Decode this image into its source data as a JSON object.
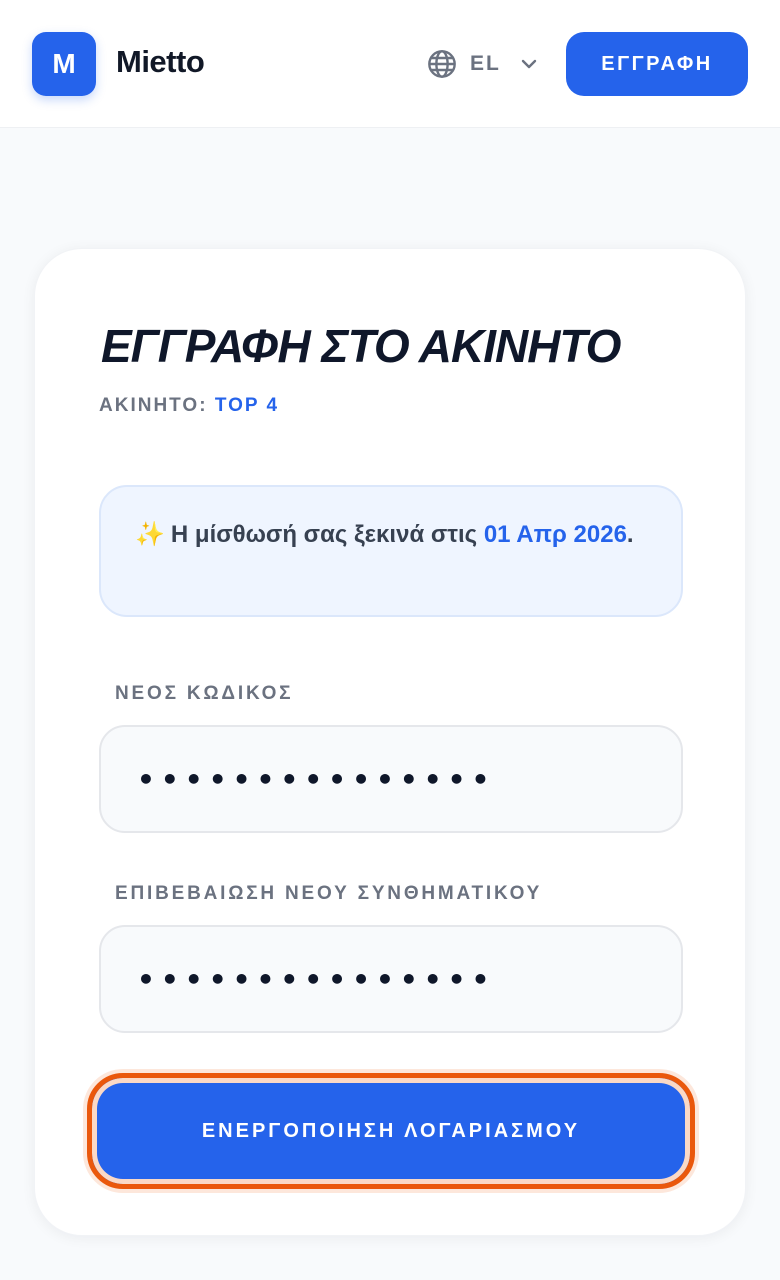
{
  "header": {
    "logo_letter": "M",
    "brand": "Mietto",
    "language_code": "EL",
    "signup_label": "ΕΓΓΡΑΦΗ"
  },
  "card": {
    "title": "ΕΓΓΡΑΦΗ ΣΤΟ ΑΚΙΝΗΤΟ",
    "property_label": "ΑΚΙΝΗΤΟ:",
    "property_value": "TOP 4",
    "notice": {
      "icon": "sparkles",
      "text_before": "Η μίσθωσή σας ξεκινά στις",
      "date": "01 Απρ 2026",
      "text_after": "."
    },
    "new_password": {
      "label": "ΝΕΟΣ ΚΩΔΙΚΟΣ",
      "value": "•••••••••••••••"
    },
    "confirm_password": {
      "label": "ΕΠΙΒΕΒΑΙΩΣΗ ΝΕΟΥ ΣΥΝΘΗΜΑΤΙΚΟΥ",
      "value": "•••••••••••••••"
    },
    "activate_label": "ΕΝΕΡΓΟΠΟΙΗΣΗ ΛΟΓΑΡΙΑΣΜΟΥ"
  },
  "colors": {
    "accent": "#2563eb",
    "focus_ring": "#ea580c",
    "background": "#f8fafc"
  }
}
